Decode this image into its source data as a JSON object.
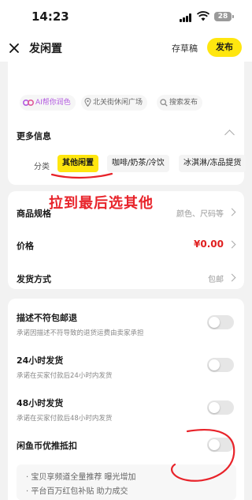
{
  "status_bar": {
    "time": "14:23",
    "battery": "28"
  },
  "header": {
    "title": "发闲置",
    "draft": "存草稿",
    "publish": "发布"
  },
  "chips": {
    "ai": "AI帮你润色",
    "location": "北关街休闲广场",
    "search": "搜索发布"
  },
  "more_info": {
    "title": "更多信息",
    "category_label": "分类",
    "categories": [
      "其他闲置",
      "咖啡/奶茶/冷饮",
      "冰淇淋/冻品提货"
    ]
  },
  "rows": {
    "spec": {
      "label": "商品规格",
      "value": "颜色、尺码等"
    },
    "price": {
      "label": "价格",
      "value": "¥0.00"
    },
    "shipping": {
      "label": "发货方式",
      "value": "包邮"
    }
  },
  "options": [
    {
      "title": "描述不符包邮退",
      "desc": "承诺因描述不符导致的退货运费由卖家承担"
    },
    {
      "title": "24小时发货",
      "desc": "承诺在买家付款后24小时内发货"
    },
    {
      "title": "48小时发货",
      "desc": "承诺在买家付款后48小时内发货"
    },
    {
      "title": "闲鱼币优推抵扣",
      "desc": ""
    }
  ],
  "benefits": [
    "宝贝享频道全量推荐 曝光增加",
    "平台百万红包补贴 助力成交"
  ],
  "annotation": "拉到最后选其他",
  "colors": {
    "accent": "#ffe60f",
    "price": "#e02020",
    "annotation": "#e8232a"
  }
}
